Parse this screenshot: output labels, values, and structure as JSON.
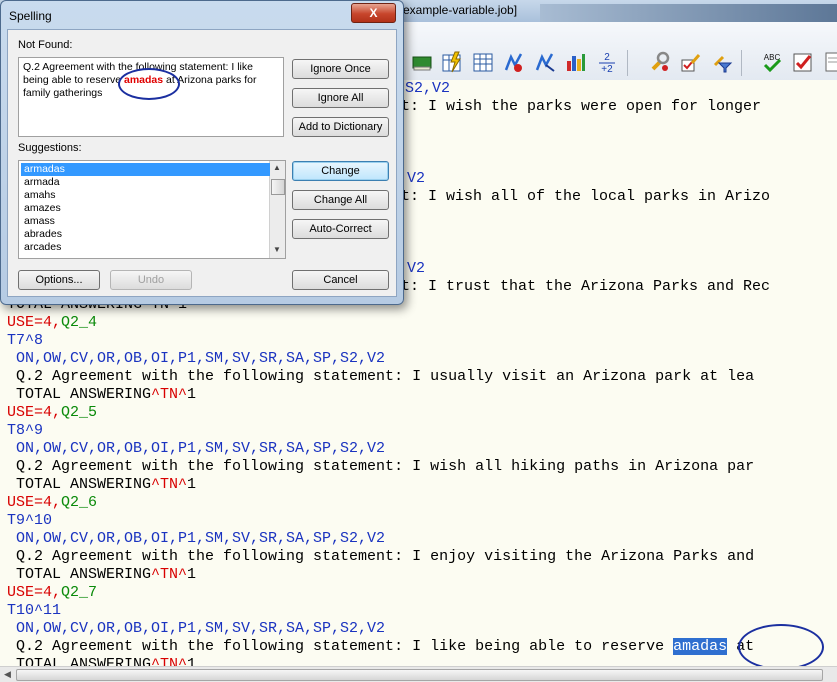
{
  "app": {
    "title_fragment": "example-variable.job]"
  },
  "toolbar": {
    "icons": [
      "book-icon",
      "flash-table-icon",
      "table-icon",
      "stats-add-icon",
      "stats-remove-icon",
      "bar-chart-icon",
      "add-two-icon",
      "wrench-icon",
      "wrench-check-icon",
      "filter-icon",
      "spellcheck-icon",
      "check-icon",
      "page-icon"
    ]
  },
  "editor": {
    "lines": [
      {
        "segments": [
          {
            "t": "S2,V2",
            "c": "c-blue"
          }
        ]
      },
      {
        "segments": [
          {
            "t": "t: I wish the parks were open for longer",
            "c": "c-blk"
          }
        ]
      },
      {
        "segments": [
          {
            "t": "V2",
            "c": "c-blue"
          }
        ]
      },
      {
        "segments": [
          {
            "t": "t: I wish all of the local parks in Arizo",
            "c": "c-blk"
          }
        ]
      },
      {
        "segments": [
          {
            "t": "V2",
            "c": "c-blue"
          }
        ]
      },
      {
        "segments": [
          {
            "t": "t: I trust that the Arizona Parks and Rec",
            "c": "c-blk"
          }
        ]
      },
      {
        "segments": [
          {
            "t": "TOTAL ANSWERING^TN^1",
            "c": "c-blk"
          }
        ]
      },
      {
        "segments": [
          {
            "t": "USE=4,",
            "c": "c-red"
          },
          {
            "t": "Q2_4",
            "c": "c-green"
          }
        ]
      },
      {
        "segments": [
          {
            "t": "T7^8",
            "c": "c-blue"
          }
        ]
      },
      {
        "segments": [
          {
            "t": " ON,OW,CV,OR,OB,OI,P1,SM,SV,SR,SA,SP,S2,V2",
            "c": "c-blue"
          }
        ]
      },
      {
        "segments": [
          {
            "t": " Q.2 Agreement with the following statement: I usually visit an Arizona park at lea",
            "c": "c-blk"
          }
        ]
      },
      {
        "segments": [
          {
            "t": " TOTAL ANSWERING",
            "c": "c-blk"
          },
          {
            "t": "^TN^",
            "c": "c-red"
          },
          {
            "t": "1",
            "c": "c-blk"
          }
        ]
      },
      {
        "segments": [
          {
            "t": "USE=4,",
            "c": "c-red"
          },
          {
            "t": "Q2_5",
            "c": "c-green"
          }
        ]
      },
      {
        "segments": [
          {
            "t": "T8^9",
            "c": "c-blue"
          }
        ]
      },
      {
        "segments": [
          {
            "t": " ON,OW,CV,OR,OB,OI,P1,SM,SV,SR,SA,SP,S2,V2",
            "c": "c-blue"
          }
        ]
      },
      {
        "segments": [
          {
            "t": " Q.2 Agreement with the following statement: I wish all hiking paths in Arizona par",
            "c": "c-blk"
          }
        ]
      },
      {
        "segments": [
          {
            "t": " TOTAL ANSWERING",
            "c": "c-blk"
          },
          {
            "t": "^TN^",
            "c": "c-red"
          },
          {
            "t": "1",
            "c": "c-blk"
          }
        ]
      },
      {
        "segments": [
          {
            "t": "USE=4,",
            "c": "c-red"
          },
          {
            "t": "Q2_6",
            "c": "c-green"
          }
        ]
      },
      {
        "segments": [
          {
            "t": "T9^10",
            "c": "c-blue"
          }
        ]
      },
      {
        "segments": [
          {
            "t": " ON,OW,CV,OR,OB,OI,P1,SM,SV,SR,SA,SP,S2,V2",
            "c": "c-blue"
          }
        ]
      },
      {
        "segments": [
          {
            "t": " Q.2 Agreement with the following statement: I enjoy visiting the Arizona Parks and",
            "c": "c-blk"
          }
        ]
      },
      {
        "segments": [
          {
            "t": " TOTAL ANSWERING",
            "c": "c-blk"
          },
          {
            "t": "^TN^",
            "c": "c-red"
          },
          {
            "t": "1",
            "c": "c-blk"
          }
        ]
      },
      {
        "segments": [
          {
            "t": "USE=4,",
            "c": "c-red"
          },
          {
            "t": "Q2_7",
            "c": "c-green"
          }
        ]
      },
      {
        "segments": [
          {
            "t": "T10^11",
            "c": "c-blue"
          }
        ]
      },
      {
        "segments": [
          {
            "t": " ON,OW,CV,OR,OB,OI,P1,SM,SV,SR,SA,SP,S2,V2",
            "c": "c-blue"
          }
        ]
      },
      {
        "segments": [
          {
            "t": " Q.2 Agreement with the following statement: I like being able to reserve ",
            "c": "c-blk"
          },
          {
            "t": "amadas",
            "c": "sel"
          },
          {
            "t": " at",
            "c": "c-blk"
          }
        ]
      },
      {
        "segments": [
          {
            "t": " TOTAL ANSWERING",
            "c": "c-blk"
          },
          {
            "t": "^TN^",
            "c": "c-red"
          },
          {
            "t": "1",
            "c": "c-blk"
          }
        ]
      }
    ]
  },
  "dialog": {
    "title": "Spelling",
    "close": "X",
    "not_found_label": "Not Found:",
    "not_found_before": "Q.2 Agreement with the following statement: I like being able to reserve ",
    "not_found_word": "amadas",
    "not_found_after": " at Arizona parks for family gatherings",
    "suggestions_label": "Suggestions:",
    "suggestions": [
      "armadas",
      "armada",
      "amahs",
      "amazes",
      "amass",
      "abrades",
      "arcades"
    ],
    "buttons": {
      "ignore_once": "Ignore Once",
      "ignore_all": "Ignore All",
      "add_to_dictionary": "Add to Dictionary",
      "change": "Change",
      "change_all": "Change All",
      "auto_correct": "Auto-Correct",
      "options": "Options...",
      "undo": "Undo",
      "cancel": "Cancel"
    }
  }
}
